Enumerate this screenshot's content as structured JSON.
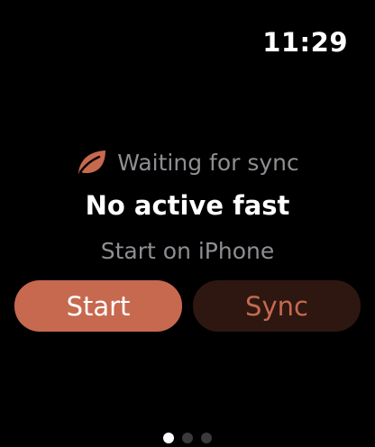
{
  "status_bar": {
    "time": "11:29"
  },
  "sync_status": {
    "icon": "leaf-icon",
    "icon_color": "#c7694f",
    "text": "Waiting for sync"
  },
  "main": {
    "title": "No active fast",
    "subtitle": "Start on iPhone"
  },
  "actions": {
    "start_label": "Start",
    "sync_label": "Sync",
    "accent_color": "#c7694f",
    "sync_bg_color": "#2e1711"
  },
  "pager": {
    "pages": 3,
    "current": 1
  }
}
